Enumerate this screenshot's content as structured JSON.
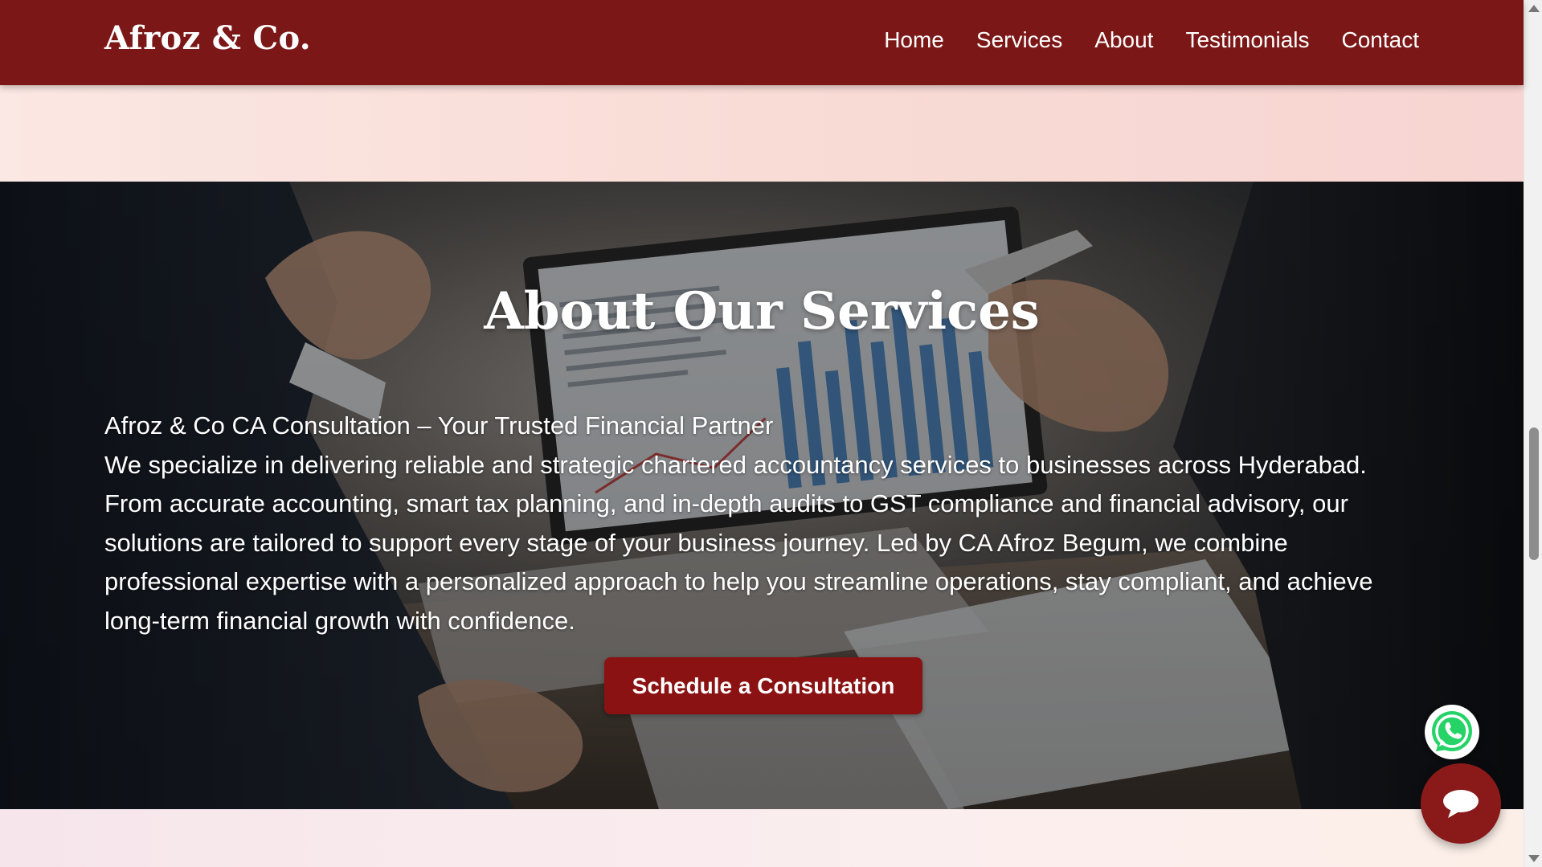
{
  "header": {
    "brand": "Afroz & Co.",
    "nav": {
      "home": "Home",
      "services": "Services",
      "about": "About",
      "testimonials": "Testimonials",
      "contact": "Contact"
    }
  },
  "hero": {
    "title": "About Our Services",
    "tagline": "Afroz & Co CA Consultation – Your Trusted Financial Partner",
    "description": "We specialize in delivering reliable and strategic chartered accountancy services to businesses across Hyderabad. From accurate accounting, smart tax planning, and in-depth audits to GST compliance and financial advisory, our solutions are tailored to support every stage of your business journey. Led by CA Afroz Begum, we combine professional expertise with a personalized approach to help you streamline operations, stay compliant, and achieve long-term financial growth with confidence.",
    "cta_label": "Schedule a Consultation"
  },
  "floating": {
    "whatsapp_icon": "whatsapp-icon",
    "chat_icon": "chat-bubble-icon"
  },
  "colors": {
    "header_bg": "#7c1717",
    "cta_bg": "#8a1212",
    "chat_bg": "#8a1a1a",
    "whatsapp_green": "#25d366"
  }
}
